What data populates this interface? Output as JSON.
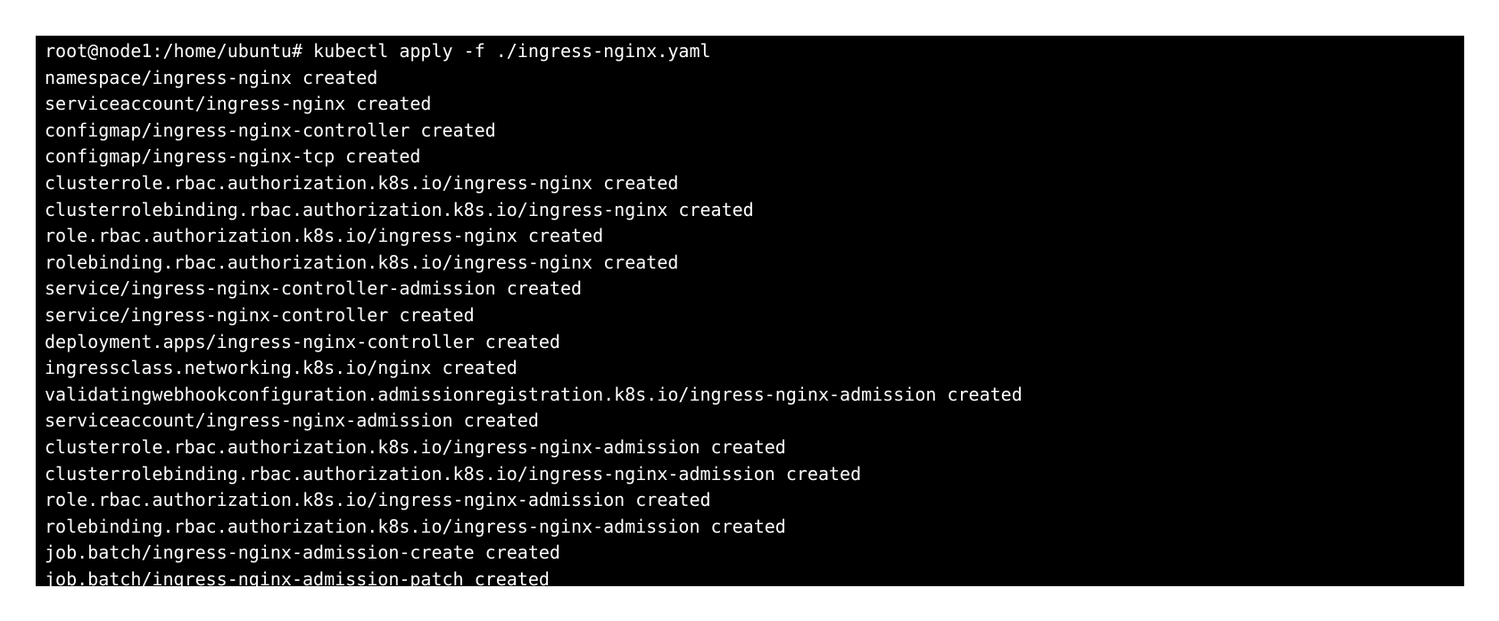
{
  "terminal": {
    "background": "#000000",
    "foreground": "#ffffff",
    "lines": [
      "root@node1:/home/ubuntu# kubectl apply -f ./ingress-nginx.yaml",
      "namespace/ingress-nginx created",
      "serviceaccount/ingress-nginx created",
      "configmap/ingress-nginx-controller created",
      "configmap/ingress-nginx-tcp created",
      "clusterrole.rbac.authorization.k8s.io/ingress-nginx created",
      "clusterrolebinding.rbac.authorization.k8s.io/ingress-nginx created",
      "role.rbac.authorization.k8s.io/ingress-nginx created",
      "rolebinding.rbac.authorization.k8s.io/ingress-nginx created",
      "service/ingress-nginx-controller-admission created",
      "service/ingress-nginx-controller created",
      "deployment.apps/ingress-nginx-controller created",
      "ingressclass.networking.k8s.io/nginx created",
      "validatingwebhookconfiguration.admissionregistration.k8s.io/ingress-nginx-admission created",
      "serviceaccount/ingress-nginx-admission created",
      "clusterrole.rbac.authorization.k8s.io/ingress-nginx-admission created",
      "clusterrolebinding.rbac.authorization.k8s.io/ingress-nginx-admission created",
      "role.rbac.authorization.k8s.io/ingress-nginx-admission created",
      "rolebinding.rbac.authorization.k8s.io/ingress-nginx-admission created",
      "job.batch/ingress-nginx-admission-create created",
      "job.batch/ingress-nginx-admission-patch created"
    ]
  }
}
